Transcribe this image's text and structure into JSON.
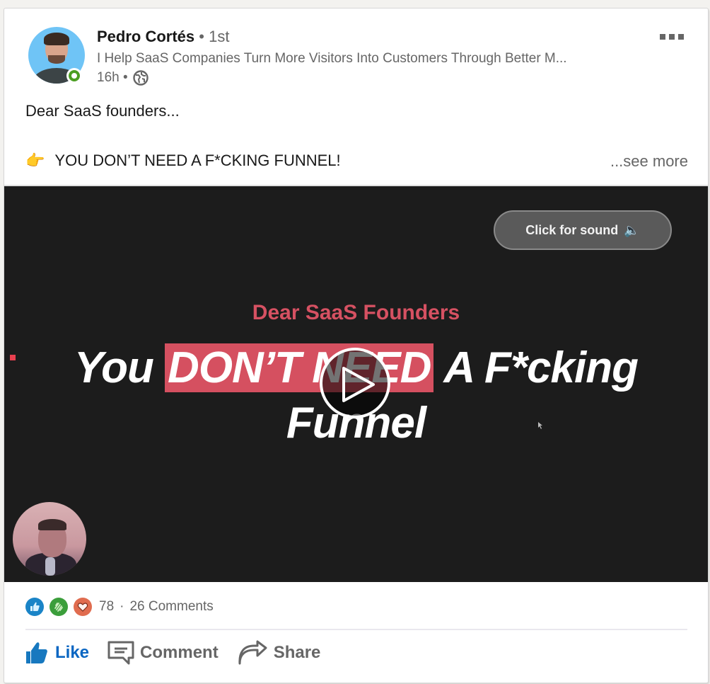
{
  "author": {
    "name": "Pedro Cortés",
    "degree": "• 1st",
    "headline": "I Help SaaS Companies Turn More Visitors Into Customers Through Better M...",
    "time": "16h •",
    "visibility_icon": "globe-icon",
    "online": true
  },
  "menu": {
    "icon": "more-options-icon"
  },
  "post": {
    "line1": "Dear SaaS founders...",
    "emoji": "👉",
    "line2": "YOU DON’T NEED A F*CKING FUNNEL!",
    "see_more": "...see more"
  },
  "video": {
    "sound_button": "Click for sound",
    "sound_icon": "🔈",
    "subtitle": "Dear SaaS Founders",
    "title_start": "You ",
    "title_highlight": "DON’T NEED",
    "title_end": " A F*cking",
    "title_line2": "Funnel",
    "highlight_color": "#d55060",
    "subtitle_color": "#d65162"
  },
  "social": {
    "reactions": [
      "like-reaction-icon",
      "celebrate-reaction-icon",
      "love-reaction-icon"
    ],
    "reaction_count": "78",
    "separator": "·",
    "comments": "26 Comments"
  },
  "actions": {
    "like": "Like",
    "comment": "Comment",
    "share": "Share"
  },
  "colors": {
    "accent": "#0a66c2",
    "online": "#4b9e22"
  }
}
